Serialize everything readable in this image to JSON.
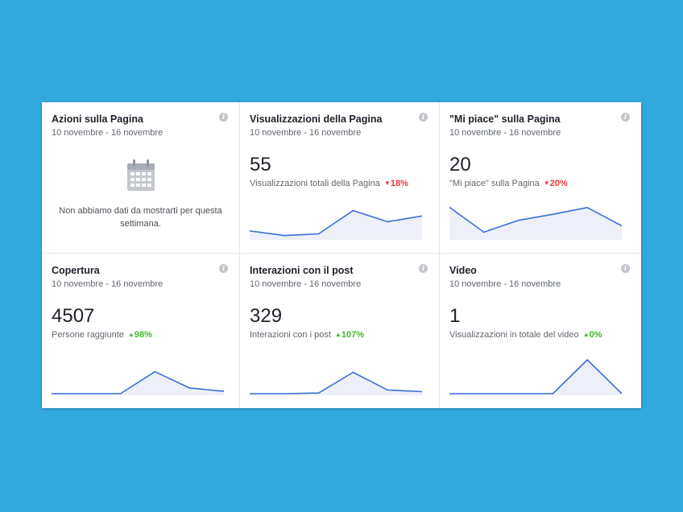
{
  "cards": [
    {
      "title": "Azioni sulla Pagina",
      "date": "10 novembre - 16 novembre",
      "empty_text": "Non abbiamo dati da mostrarti per questa settimana.",
      "icon": "calendar-icon"
    },
    {
      "title": "Visualizzazioni della Pagina",
      "date": "10 novembre - 16 novembre",
      "value": "55",
      "label": "Visualizzazioni totali della Pagina",
      "delta": "18%",
      "trend": "down",
      "spark": [
        0.22,
        0.08,
        0.13,
        0.82,
        0.49,
        0.66
      ]
    },
    {
      "title": "\"Mi piace\" sulla Pagina",
      "date": "10 novembre - 16 novembre",
      "value": "20",
      "label": "\"Mi piace\" sulla Pagina",
      "delta": "20%",
      "trend": "down",
      "spark": [
        0.92,
        0.18,
        0.53,
        0.71,
        0.91,
        0.37
      ]
    },
    {
      "title": "Copertura",
      "date": "10 novembre - 16 novembre",
      "value": "4507",
      "label": "Persone raggiunte",
      "delta": "98%",
      "trend": "up",
      "spark": [
        0.0,
        0.0,
        0.0,
        0.65,
        0.17,
        0.07
      ]
    },
    {
      "title": "Interazioni con il post",
      "date": "10 novembre - 16 novembre",
      "value": "329",
      "label": "Interazioni con i post",
      "delta": "107%",
      "trend": "up",
      "spark": [
        0.0,
        0.0,
        0.02,
        0.63,
        0.11,
        0.06
      ]
    },
    {
      "title": "Video",
      "date": "10 novembre - 16 novembre",
      "value": "1",
      "label": "Visualizzazioni in totale del video",
      "delta": "0%",
      "trend": "up",
      "spark": [
        0.0,
        0.0,
        0.0,
        0.0,
        1.0,
        0.0
      ]
    }
  ],
  "info_glyph": "i",
  "colors": {
    "background": "#31a9dc",
    "line": "#3b6fd9",
    "fill": "#edf0f8",
    "down": "#e8383c",
    "up": "#42b72a"
  }
}
